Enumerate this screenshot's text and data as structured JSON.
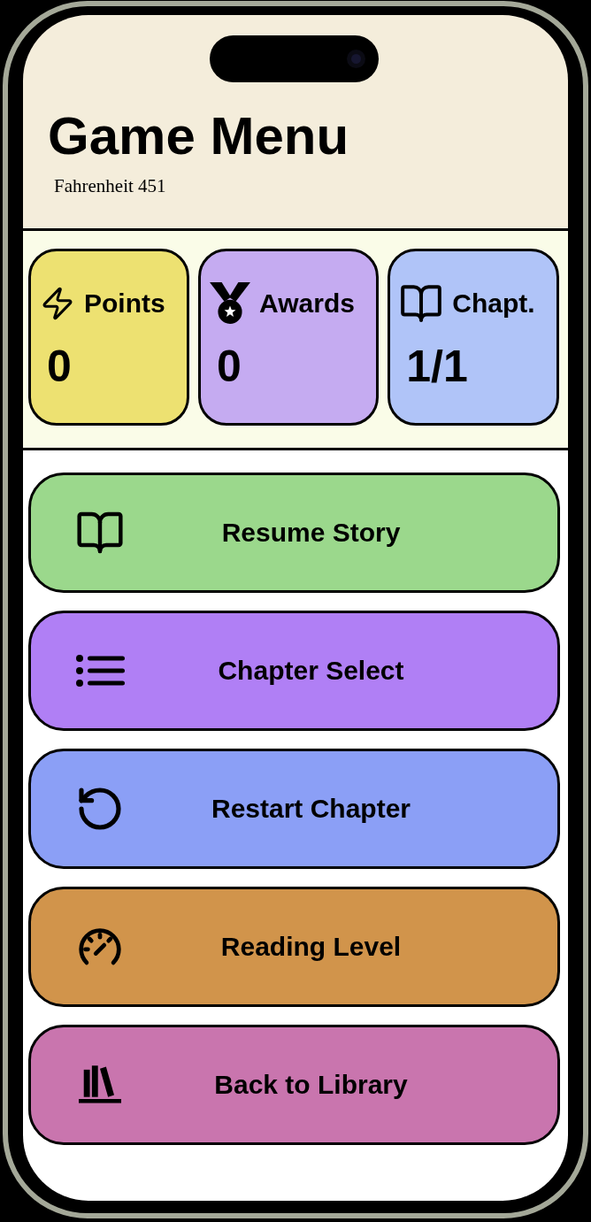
{
  "screen": {
    "title": "Game Menu",
    "subtitle": "Fahrenheit 451"
  },
  "stats": [
    {
      "label": "Points",
      "value": "0",
      "color": "#ede171"
    },
    {
      "label": "Awards",
      "value": "0",
      "color": "#c5abf1"
    },
    {
      "label": "Chapt.",
      "value": "1/1",
      "color": "#b0c4f8"
    }
  ],
  "menu": [
    {
      "label": "Resume Story",
      "color": "#9bd88c"
    },
    {
      "label": "Chapter Select",
      "color": "#b07ff5"
    },
    {
      "label": "Restart Chapter",
      "color": "#8b9ff6"
    },
    {
      "label": "Reading Level",
      "color": "#d1944b"
    },
    {
      "label": "Back to Library",
      "color": "#c975ae"
    }
  ]
}
